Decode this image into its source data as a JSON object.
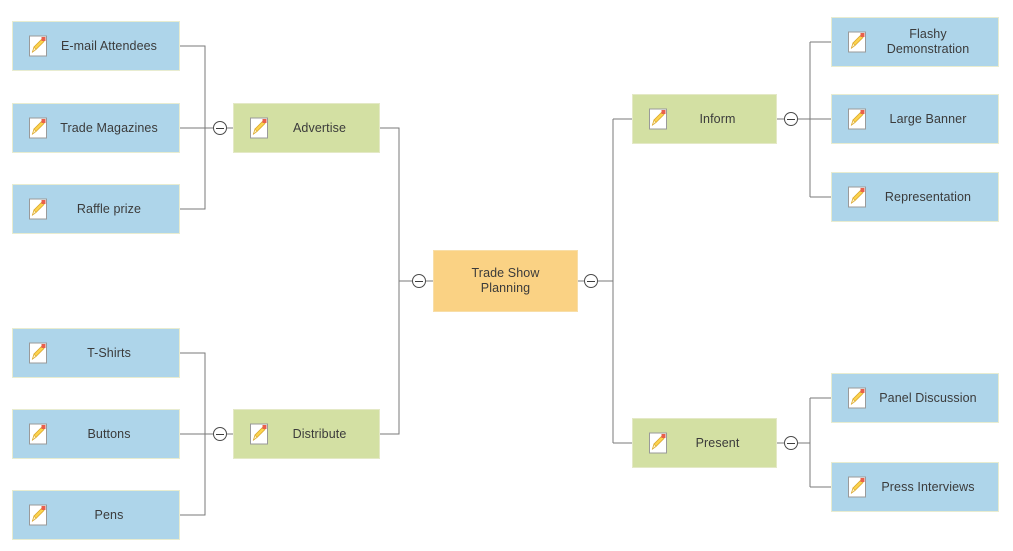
{
  "diagram": {
    "type": "mind-map",
    "title": "Trade Show Planning",
    "colors": {
      "leaf": "#aed5ea",
      "branch": "#d3e0a3",
      "root": "#fad284",
      "connector": "#7a7a7a",
      "text": "#3b3b3b",
      "background": "#ffffff"
    },
    "icon_name": "note-pencil-icon"
  },
  "root": {
    "label": "Trade Show\nPlanning",
    "has_icon": false
  },
  "branches": [
    {
      "id": "advertise",
      "label": "Advertise",
      "side": "left",
      "children": [
        {
          "label": "E-mail Attendees"
        },
        {
          "label": "Trade Magazines"
        },
        {
          "label": "Raffle prize"
        }
      ]
    },
    {
      "id": "distribute",
      "label": "Distribute",
      "side": "left",
      "children": [
        {
          "label": "T-Shirts"
        },
        {
          "label": "Buttons"
        },
        {
          "label": "Pens"
        }
      ]
    },
    {
      "id": "inform",
      "label": "Inform",
      "side": "right",
      "children": [
        {
          "label": "Flashy\nDemonstration"
        },
        {
          "label": "Large Banner"
        },
        {
          "label": "Representation"
        }
      ]
    },
    {
      "id": "present",
      "label": "Present",
      "side": "right",
      "children": [
        {
          "label": "Panel Discussion"
        },
        {
          "label": "Press Interviews"
        }
      ]
    }
  ],
  "toggles": [
    {
      "id": "toggle-advertise",
      "state": "expanded"
    },
    {
      "id": "toggle-distribute",
      "state": "expanded"
    },
    {
      "id": "toggle-root-left",
      "state": "expanded"
    },
    {
      "id": "toggle-root-right",
      "state": "expanded"
    },
    {
      "id": "toggle-inform",
      "state": "expanded"
    },
    {
      "id": "toggle-present",
      "state": "expanded"
    }
  ]
}
